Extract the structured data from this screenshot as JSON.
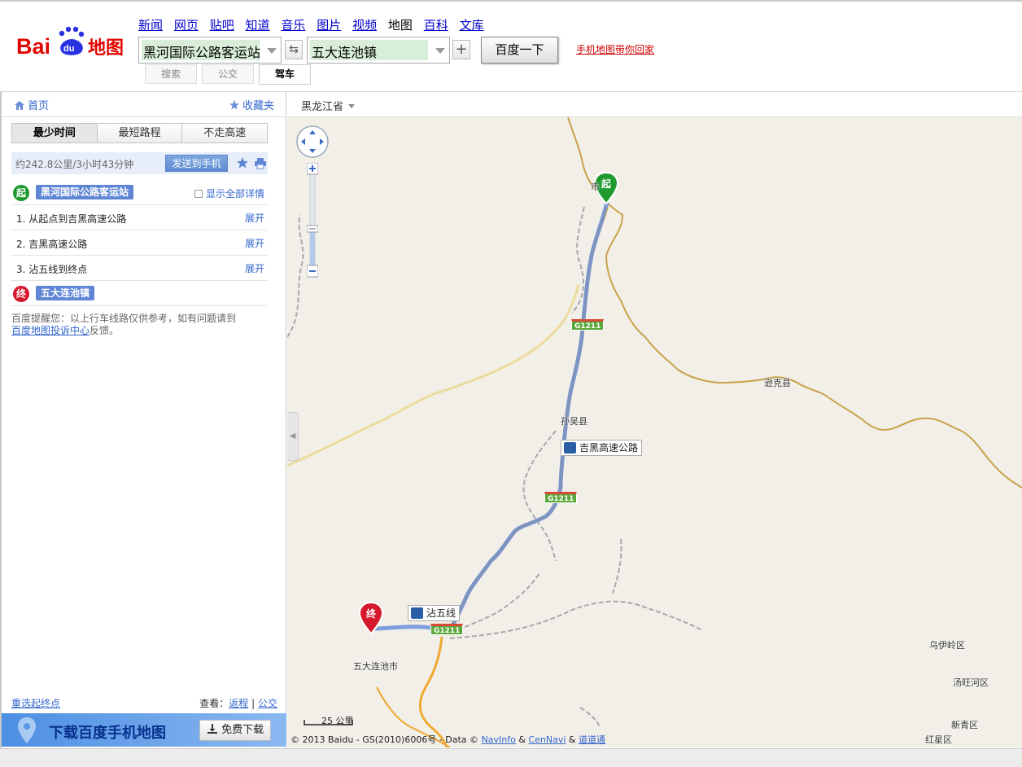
{
  "header": {
    "logo_text": "Baidu地图",
    "nav": [
      "新闻",
      "网页",
      "贴吧",
      "知道",
      "音乐",
      "图片",
      "视频",
      "地图",
      "百科",
      "文库"
    ],
    "nav_current": "地图",
    "start_value": "黑河国际公路客运站",
    "end_value": "五大连池镇",
    "swap_symbol": "⇆",
    "add_symbol": "+",
    "search_button": "百度一下",
    "mobile_link": "手机地图带你回家",
    "modes": {
      "search": "搜索",
      "bus": "公交",
      "drive": "驾车"
    }
  },
  "left_panel": {
    "home": "首页",
    "favorites": "收藏夹",
    "tabs": [
      "最少时间",
      "最短路程",
      "不走高速"
    ],
    "active_tab": "最少时间",
    "summary": "约242.8公里/3小时43分钟",
    "send_to_phone": "发送到手机",
    "start_badge": "起",
    "start_name": "黑河国际公路客运站",
    "show_all_details": "显示全部详情",
    "steps": [
      {
        "text": "1. 从起点到吉黑高速公路",
        "action": "展开"
      },
      {
        "text": "2. 吉黑高速公路",
        "action": "展开"
      },
      {
        "text": "3. 沾五线到终点",
        "action": "展开"
      }
    ],
    "end_badge": "终",
    "end_name": "五大连池镇",
    "notice_prefix": "百度提醒您：以上行车线路仅供参考，如有问题请到",
    "notice_link": "百度地图投诉中心",
    "notice_suffix": "反馈。",
    "reselect": "重选起终点",
    "view_label": "查看：",
    "view_return": "返程",
    "view_sep": "|",
    "view_bus": "公交",
    "download_text": "下载百度手机地图",
    "download_button": "免费下载"
  },
  "map": {
    "province": "黑龙江省",
    "labels": {
      "heihe": "市",
      "xunke": "逊克县",
      "sunwu": "孙吴县",
      "wudalianchi": "五大连池市",
      "wuyiling": "乌伊岭区",
      "tangwanghe": "汤旺河区",
      "xinqing": "新青区",
      "hongxing": "红星区"
    },
    "callouts": {
      "jihei": "吉黑高速公路",
      "zhanwu": "沾五线"
    },
    "shields": [
      "G1211",
      "G1211",
      "G1211"
    ],
    "start_marker": "起",
    "end_marker": "终",
    "scale": "25 公里",
    "copyright_prefix": "© 2013 Baidu - GS(2010)6006号 - Data ©",
    "copyright_navinfo": "NavInfo",
    "copyright_amp1": "&",
    "copyright_cennavi": "CenNavi",
    "copyright_amp2": "&",
    "copyright_daodao": "道道通"
  },
  "colors": {
    "route": "#6b8fd8",
    "start_green": "#1e9a2e",
    "end_red": "#d5182d",
    "border_line": "#c9a24a",
    "highway": "#f0a830"
  }
}
